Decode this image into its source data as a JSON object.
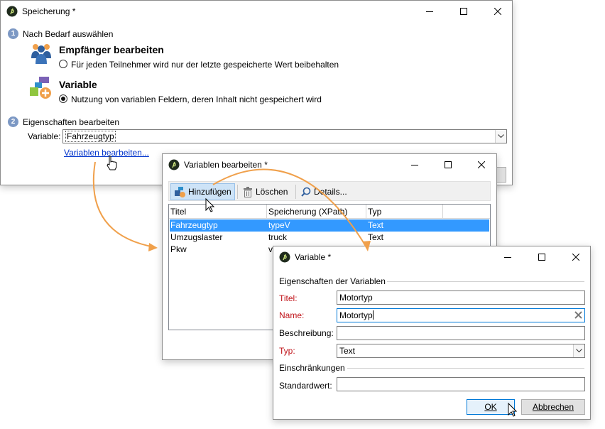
{
  "main_window": {
    "title": "Speicherung *",
    "step1": {
      "number": "1",
      "label": "Nach Bedarf auswählen"
    },
    "option_recipient": {
      "heading": "Empfänger bearbeiten",
      "radio_label": "Für jeden Teilnehmer wird nur der letzte gespeicherte Wert beibehalten",
      "icon": "users-group-icon",
      "checked": false
    },
    "option_variable": {
      "heading": "Variable",
      "radio_label": "Nutzung von variablen Feldern, deren Inhalt nicht gespeichert wird",
      "icon": "variable-add-icon",
      "checked": true
    },
    "step2": {
      "number": "2",
      "label": "Eigenschaften bearbeiten"
    },
    "variable_label": "Variable:",
    "variable_value": "Fahrzeugtyp",
    "edit_link": "Variablen bearbeiten..."
  },
  "vars_window": {
    "title": "Variablen bearbeiten *",
    "toolbar": {
      "add": "Hinzufügen",
      "delete": "Löschen",
      "details": "Details..."
    },
    "columns": [
      "Titel",
      "Speicherung (XPath)",
      "Typ"
    ],
    "rows": [
      {
        "title": "Fahrzeugtyp",
        "xpath": "typeV",
        "type": "Text",
        "selected": true
      },
      {
        "title": "Umzugslaster",
        "xpath": "truck",
        "type": "Text",
        "selected": false
      },
      {
        "title": "Pkw",
        "xpath": "v",
        "type": "",
        "selected": false
      }
    ]
  },
  "var_window": {
    "title": "Variable *",
    "section_props": "Eigenschaften der Variablen",
    "title_label": "Titel:",
    "title_value": "Motortyp",
    "name_label": "Name:",
    "name_value": "Motortyp",
    "description_label": "Beschreibung:",
    "description_value": "",
    "type_label": "Typ:",
    "type_value": "Text",
    "section_constraints": "Einschränkungen",
    "default_label": "Standardwert:",
    "default_value": "",
    "ok_label": "OK",
    "cancel_label": "Abbrechen"
  },
  "colors": {
    "accent_arrow": "#f0a04b",
    "selection": "#3399ff",
    "required": "#c0141a",
    "link": "#0033cc"
  }
}
